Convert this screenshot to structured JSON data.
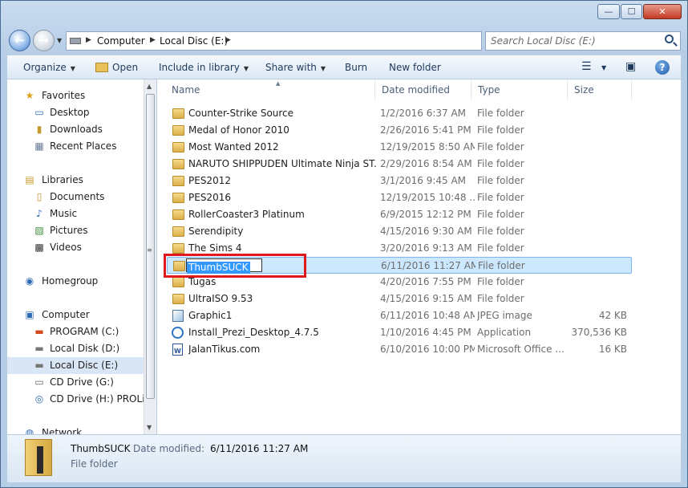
{
  "address": {
    "crumbs": [
      "Computer",
      "Local Disc (E:)"
    ]
  },
  "search": {
    "placeholder": "Search Local Disc (E:)"
  },
  "toolbar": {
    "organize": "Organize",
    "open": "Open",
    "include": "Include in library",
    "share": "Share with",
    "burn": "Burn",
    "new_folder": "New folder"
  },
  "sidebar": {
    "favorites": "Favorites",
    "desktop": "Desktop",
    "downloads": "Downloads",
    "recent": "Recent Places",
    "libraries": "Libraries",
    "documents": "Documents",
    "music": "Music",
    "pictures": "Pictures",
    "videos": "Videos",
    "homegroup": "Homegroup",
    "computer": "Computer",
    "program": "PROGRAM (C:)",
    "local_d": "Local Disk (D:)",
    "local_e": "Local Disc (E:)",
    "cd_g": "CD Drive (G:)",
    "cd_h": "CD Drive (H:) PROLiNK",
    "network": "Network"
  },
  "columns": {
    "name": "Name",
    "date": "Date modified",
    "type": "Type",
    "size": "Size"
  },
  "files": [
    {
      "name": "Counter-Strike Source",
      "date": "1/2/2016 6:37 AM",
      "type": "File folder",
      "size": "",
      "icon": "folder-icon"
    },
    {
      "name": "Medal of Honor 2010",
      "date": "2/26/2016 5:41 PM",
      "type": "File folder",
      "size": "",
      "icon": "folder-icon"
    },
    {
      "name": "Most Wanted 2012",
      "date": "12/19/2015 8:50 AM",
      "type": "File folder",
      "size": "",
      "icon": "folder-icon"
    },
    {
      "name": "NARUTO SHIPPUDEN Ultimate Ninja ST...",
      "date": "2/29/2016 8:54 AM",
      "type": "File folder",
      "size": "",
      "icon": "folder-icon"
    },
    {
      "name": "PES2012",
      "date": "3/1/2016 9:45 AM",
      "type": "File folder",
      "size": "",
      "icon": "folder-icon"
    },
    {
      "name": "PES2016",
      "date": "12/19/2015 10:48 ...",
      "type": "File folder",
      "size": "",
      "icon": "folder-icon"
    },
    {
      "name": "RollerCoaster3 Platinum",
      "date": "6/9/2015 12:12 PM",
      "type": "File folder",
      "size": "",
      "icon": "folder-icon"
    },
    {
      "name": "Serendipity",
      "date": "4/15/2016 9:30 AM",
      "type": "File folder",
      "size": "",
      "icon": "folder-icon"
    },
    {
      "name": "The Sims 4",
      "date": "3/20/2016 9:13 AM",
      "type": "File folder",
      "size": "",
      "icon": "folder-icon"
    },
    {
      "name": "ThumbSUCK",
      "date": "6/11/2016 11:27 AM",
      "type": "File folder",
      "size": "",
      "icon": "folder-icon"
    },
    {
      "name": "Tugas",
      "date": "4/20/2016 7:55 PM",
      "type": "File folder",
      "size": "",
      "icon": "folder-icon"
    },
    {
      "name": "UltraISO 9.53",
      "date": "4/15/2016 9:15 AM",
      "type": "File folder",
      "size": "",
      "icon": "folder-icon"
    },
    {
      "name": "Graphic1",
      "date": "6/11/2016 10:48 AM",
      "type": "JPEG image",
      "size": "42 KB",
      "icon": "image-icon"
    },
    {
      "name": "Install_Prezi_Desktop_4.7.5",
      "date": "1/10/2016 4:45 PM",
      "type": "Application",
      "size": "370,536 KB",
      "icon": "application-icon"
    },
    {
      "name": "JalanTikus.com",
      "date": "6/10/2016 10:00 PM",
      "type": "Microsoft Office ...",
      "size": "16 KB",
      "icon": "word-document-icon"
    }
  ],
  "rename": {
    "value": "ThumbSUCK"
  },
  "details": {
    "name": "ThumbSUCK",
    "date_label": "Date modified:",
    "date_value": "6/11/2016 11:27 AM",
    "type": "File folder"
  }
}
